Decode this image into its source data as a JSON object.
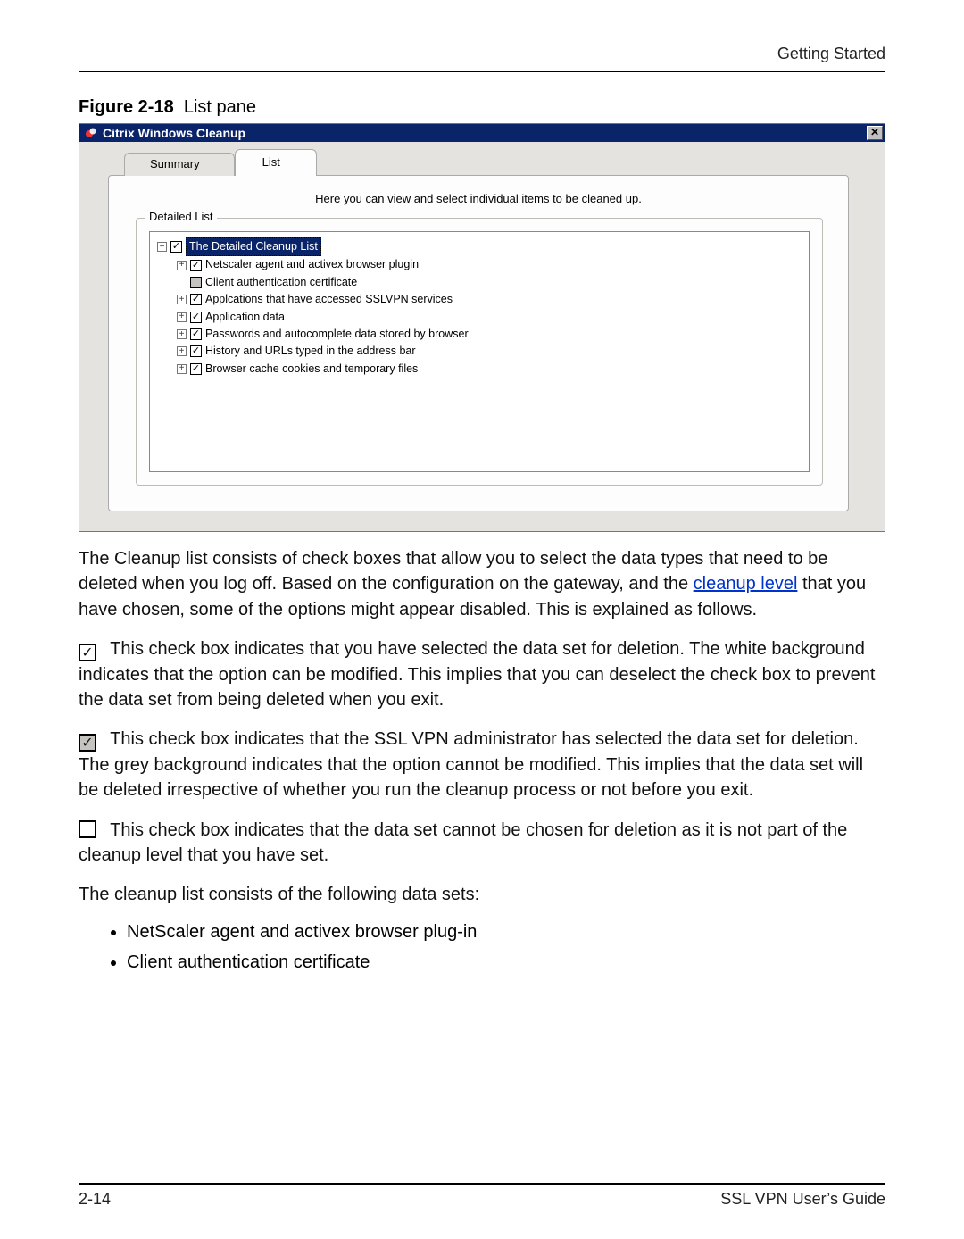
{
  "header": {
    "section": "Getting Started"
  },
  "figure": {
    "label": "Figure 2-18",
    "caption": "List pane"
  },
  "screenshot": {
    "title": "Citrix Windows Cleanup",
    "close_glyph": "✕",
    "tabs": {
      "summary": "Summary",
      "list": "List"
    },
    "hint": "Here you can view and select individual items to be cleaned up.",
    "groupbox_legend": "Detailed List",
    "tree": {
      "root": "The Detailed Cleanup List",
      "items": [
        {
          "exp": "+",
          "checked": true,
          "grey": false,
          "label": "Netscaler agent and activex browser plugin"
        },
        {
          "exp": "",
          "checked": false,
          "grey": true,
          "label": "Client authentication certificate"
        },
        {
          "exp": "+",
          "checked": true,
          "grey": false,
          "label": "Applcations that have accessed SSLVPN services"
        },
        {
          "exp": "+",
          "checked": true,
          "grey": false,
          "label": "Application data"
        },
        {
          "exp": "+",
          "checked": true,
          "grey": false,
          "label": "Passwords and autocomplete data stored by browser"
        },
        {
          "exp": "+",
          "checked": true,
          "grey": false,
          "label": "History and URLs typed in the address bar"
        },
        {
          "exp": "+",
          "checked": true,
          "grey": false,
          "label": "Browser cache cookies and temporary files"
        }
      ]
    },
    "glyph": {
      "minus": "−",
      "plus": "+",
      "check": "✓"
    }
  },
  "body": {
    "p1a": "The Cleanup list consists of check boxes that allow you to select the data types that need to be deleted when you log off. Based on the configuration on the gateway, and the ",
    "p1link": "cleanup level",
    "p1b": " that you have chosen, some of the options might appear disabled. This is explained as follows.",
    "p2": "This check box indicates that you have selected the data set for deletion. The white background indicates that the option can be modified. This implies that you can deselect the check box to prevent the data set from being deleted when you exit.",
    "p3": "This check box indicates that the SSL VPN administrator has selected the data set for deletion. The grey background indicates that the option cannot be modified. This implies that the data set will be deleted irrespective of whether you run the cleanup process or not before you exit.",
    "p4": "This check box indicates that the data set cannot be chosen for deletion as it is not part of the cleanup level that you have set.",
    "p5": "The cleanup list consists of the following data sets:",
    "bullets": [
      "NetScaler agent and activex browser plug-in",
      "Client authentication certificate"
    ]
  },
  "footer": {
    "page": "2-14",
    "doc": "SSL VPN User’s Guide"
  }
}
